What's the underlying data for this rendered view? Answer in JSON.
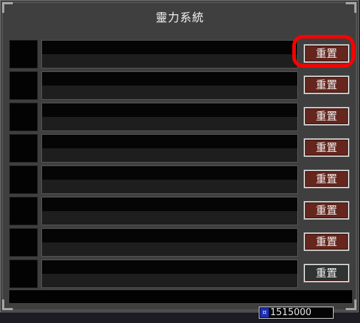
{
  "window": {
    "title": "靈力系統"
  },
  "rows": [
    {
      "reset_label": "重置"
    },
    {
      "reset_label": "重置"
    },
    {
      "reset_label": "重置"
    },
    {
      "reset_label": "重置"
    },
    {
      "reset_label": "重置"
    },
    {
      "reset_label": "重置"
    },
    {
      "reset_label": "重置"
    },
    {
      "reset_label": "重置"
    }
  ],
  "currency": {
    "icon": "money-icon",
    "amount": "1515000"
  },
  "colors": {
    "reset_active": "#65261d",
    "reset_inactive": "#2f3433",
    "highlight": "#ff0000"
  }
}
